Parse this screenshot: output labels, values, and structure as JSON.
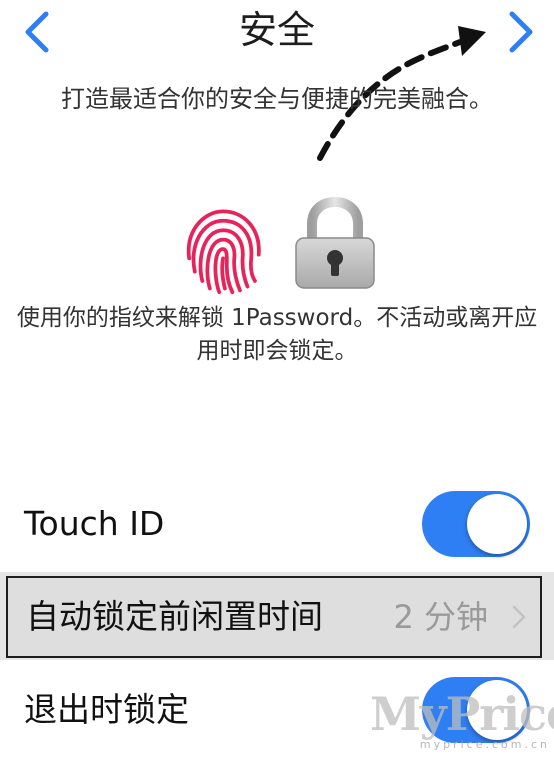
{
  "nav": {
    "title": "安全",
    "back_icon": "chevron-left-icon",
    "forward_icon": "chevron-right-icon",
    "accent_color": "#2f7ff4"
  },
  "intro": {
    "text": "打造最适合你的安全与便捷的完美融合。"
  },
  "illustration": {
    "fingerprint_icon": "fingerprint-icon",
    "fingerprint_color": "#e8235a",
    "lock_icon": "padlock-icon"
  },
  "description": {
    "text": "使用你的指纹来解锁 1Password。不活动或离开应用时即会锁定。"
  },
  "settings": {
    "touch_id": {
      "label": "Touch ID",
      "enabled": true
    },
    "auto_lock": {
      "label": "自动锁定前闲置时间",
      "value": "2 分钟",
      "chevron_icon": "chevron-right-icon"
    },
    "lock_on_exit": {
      "label": "退出时锁定",
      "enabled": true
    }
  },
  "watermark": {
    "main": "MyPrice",
    "sub": "myprice.com.cn"
  }
}
